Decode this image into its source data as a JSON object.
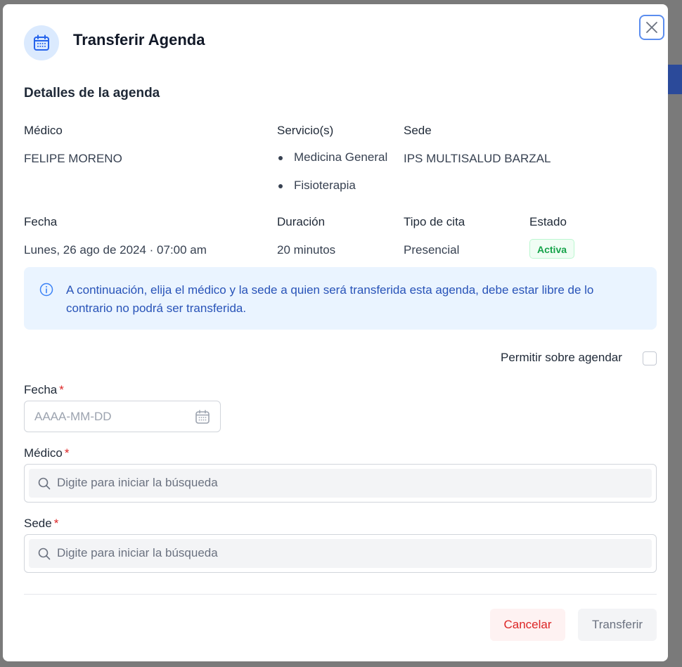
{
  "modal": {
    "title": "Transferir Agenda",
    "close_icon": "close-icon",
    "header_icon": "calendar-icon"
  },
  "details": {
    "section_title": "Detalles de la agenda",
    "medico_label": "Médico",
    "medico_value": "FELIPE MORENO",
    "servicios_label": "Servicio(s)",
    "servicios": [
      "Medicina General",
      "Fisioterapia"
    ],
    "sede_label": "Sede",
    "sede_value": "IPS MULTISALUD BARZAL",
    "fecha_label": "Fecha",
    "fecha_value": "Lunes, 26 ago de 2024 · 07:00 am",
    "duracion_label": "Duración",
    "duracion_value": "20 minutos",
    "tipo_label": "Tipo de cita",
    "tipo_value": "Presencial",
    "estado_label": "Estado",
    "estado_value": "Activa"
  },
  "info": {
    "text": "A continuación, elija el médico y la sede a quien será transferida esta agenda, debe estar libre de lo contrario no podrá ser transferida."
  },
  "form": {
    "overbook_label": "Permitir sobre agendar",
    "overbook_checked": false,
    "fecha_label": "Fecha",
    "fecha_placeholder": "AAAA-MM-DD",
    "medico_label": "Médico",
    "medico_placeholder": "Digite para iniciar la búsqueda",
    "sede_label": "Sede",
    "sede_placeholder": "Digite para iniciar la búsqueda",
    "required_mark": "*"
  },
  "actions": {
    "cancel_label": "Cancelar",
    "transfer_label": "Transferir"
  },
  "colors": {
    "primary": "#2853b8",
    "danger": "#dc2626",
    "success": "#16a34a",
    "info_bg": "#eaf4ff"
  }
}
